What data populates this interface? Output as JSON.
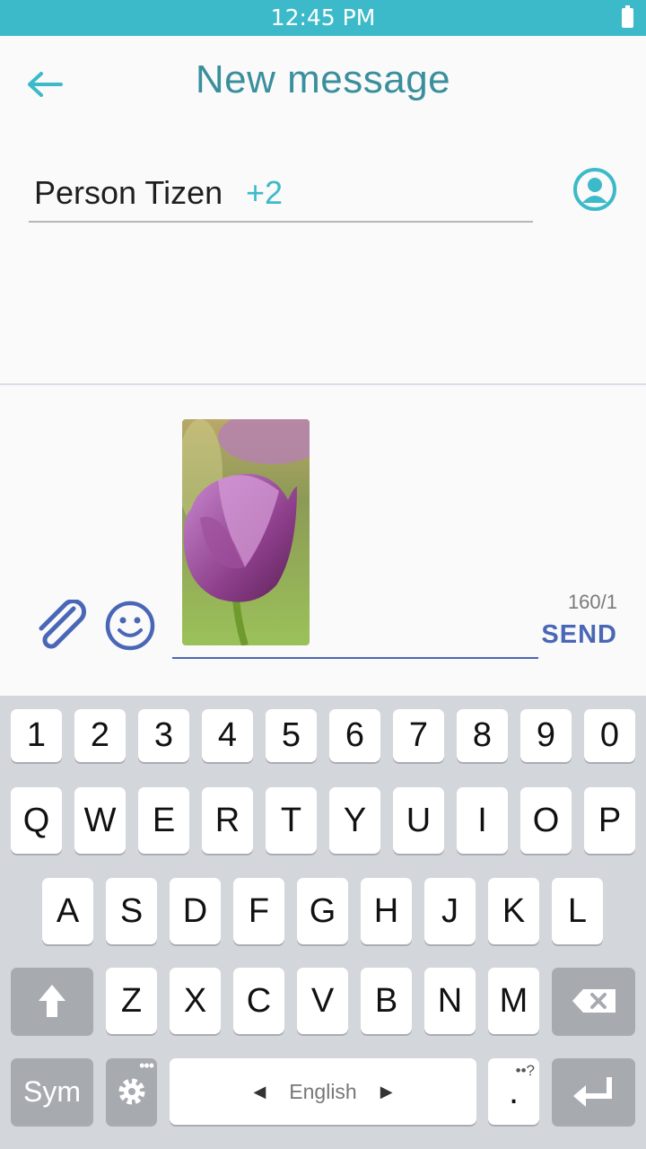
{
  "status_bar": {
    "time": "12:45 PM"
  },
  "header": {
    "title": "New message"
  },
  "recipient": {
    "name": "Person Tizen",
    "extra_count": "+2"
  },
  "composer": {
    "char_counter": "160/1",
    "send_label": "SEND"
  },
  "keyboard": {
    "row_numbers": [
      "1",
      "2",
      "3",
      "4",
      "5",
      "6",
      "7",
      "8",
      "9",
      "0"
    ],
    "row_top": [
      "Q",
      "W",
      "E",
      "R",
      "T",
      "Y",
      "U",
      "I",
      "O",
      "P"
    ],
    "row_middle": [
      "A",
      "S",
      "D",
      "F",
      "G",
      "H",
      "J",
      "K",
      "L"
    ],
    "row_bottom": [
      "Z",
      "X",
      "C",
      "V",
      "B",
      "N",
      "M"
    ],
    "sym_label": "Sym",
    "language_label": "English",
    "punct_label": ".",
    "punct_hint": "••?"
  },
  "colors": {
    "accent": "#3dbac9",
    "title": "#3a8f9c",
    "send": "#4a66b7"
  }
}
